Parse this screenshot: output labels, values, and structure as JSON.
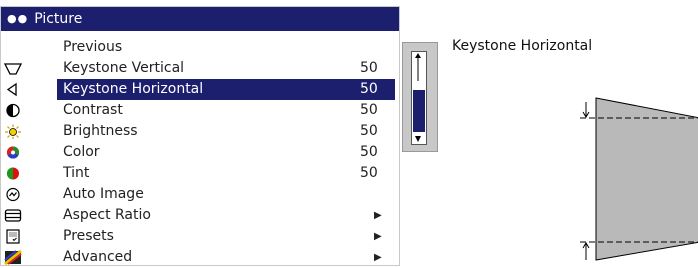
{
  "menu": {
    "title": "Picture",
    "items": [
      {
        "label": "Previous",
        "value": "",
        "icon": "none"
      },
      {
        "label": "Keystone Vertical",
        "value": "50",
        "icon": "keystone-vertical-icon"
      },
      {
        "label": "Keystone Horizontal",
        "value": "50",
        "icon": "keystone-horizontal-icon",
        "selected": true
      },
      {
        "label": "Contrast",
        "value": "50",
        "icon": "contrast-icon"
      },
      {
        "label": "Brightness",
        "value": "50",
        "icon": "brightness-icon"
      },
      {
        "label": "Color",
        "value": "50",
        "icon": "color-icon"
      },
      {
        "label": "Tint",
        "value": "50",
        "icon": "tint-icon"
      },
      {
        "label": "Auto Image",
        "value": "",
        "icon": "auto-image-icon"
      },
      {
        "label": "Aspect Ratio",
        "value": "",
        "icon": "aspect-ratio-icon",
        "submenu": true
      },
      {
        "label": "Presets",
        "value": "",
        "icon": "presets-icon",
        "submenu": true
      },
      {
        "label": "Advanced",
        "value": "",
        "icon": "advanced-icon",
        "submenu": true
      }
    ]
  },
  "diagram": {
    "title": "Keystone Horizontal"
  },
  "colors": {
    "accent": "#1c1f6e"
  }
}
